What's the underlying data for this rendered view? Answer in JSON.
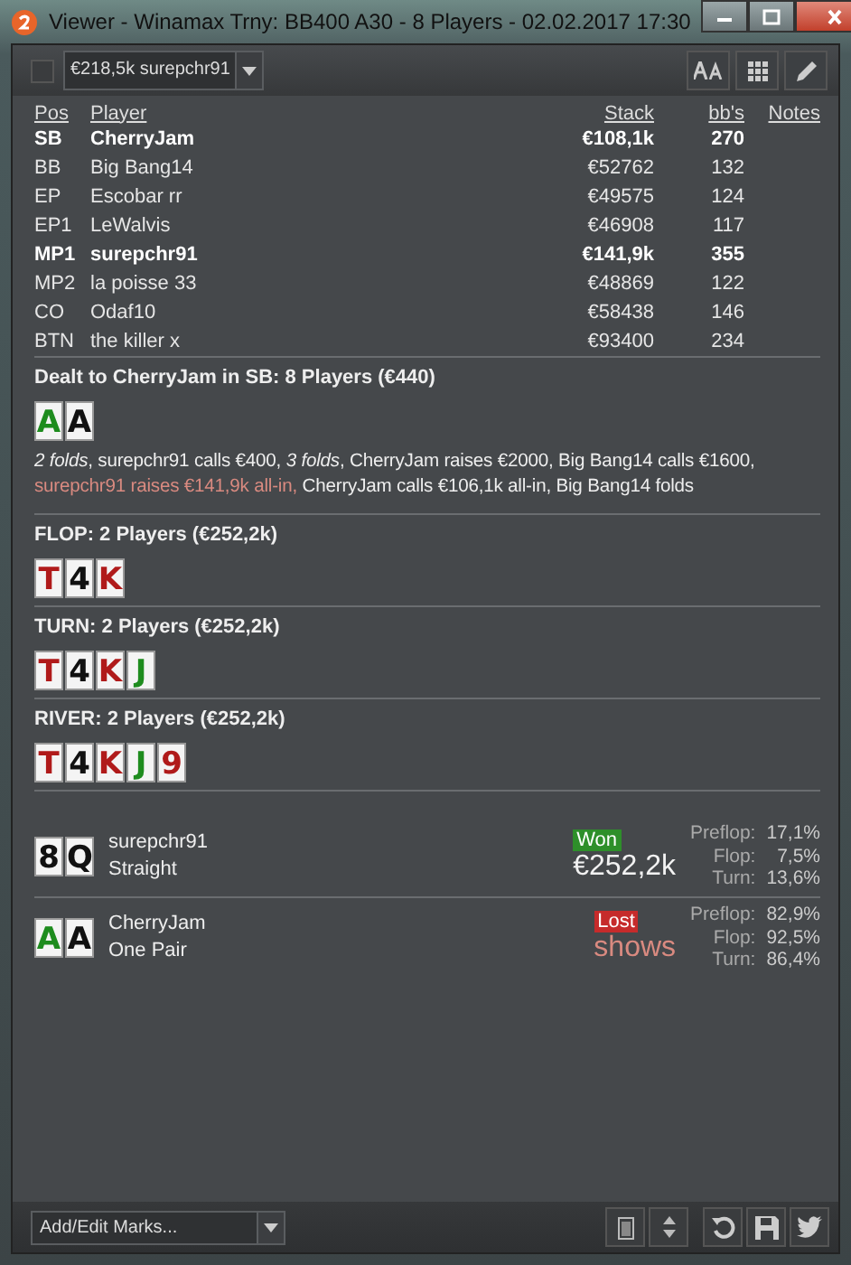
{
  "window": {
    "title": "Viewer - Winamax Trny: BB400 A30 - 8 Players - 02.02.2017 17:30"
  },
  "toolbar": {
    "checkbox_checked": false,
    "hand_select": "€218,5k surepchr91"
  },
  "players": {
    "columns": [
      "Pos",
      "Player",
      "Stack",
      "bb's",
      "Notes"
    ],
    "rows": [
      {
        "pos": "SB",
        "player": "CherryJam",
        "stack": "€108,1k",
        "bbs": "270",
        "bold": true
      },
      {
        "pos": "BB",
        "player": "Big Bang14",
        "stack": "€52762",
        "bbs": "132",
        "bold": false
      },
      {
        "pos": "EP",
        "player": "Escobar rr",
        "stack": "€49575",
        "bbs": "124",
        "bold": false
      },
      {
        "pos": "EP1",
        "player": "LeWalvis",
        "stack": "€46908",
        "bbs": "117",
        "bold": false
      },
      {
        "pos": "MP1",
        "player": "surepchr91",
        "stack": "€141,9k",
        "bbs": "355",
        "bold": true
      },
      {
        "pos": "MP2",
        "player": "la poisse 33",
        "stack": "€48869",
        "bbs": "122",
        "bold": false
      },
      {
        "pos": "CO",
        "player": "Odaf10",
        "stack": "€58438",
        "bbs": "146",
        "bold": false
      },
      {
        "pos": "BTN",
        "player": "the killer x",
        "stack": "€93400",
        "bbs": "234",
        "bold": false
      }
    ]
  },
  "streets": [
    {
      "heading": "Dealt to CherryJam in SB: 8 Players (€440)",
      "cards": [
        {
          "rank": "A",
          "color": "#1e8c1e"
        },
        {
          "rank": "A",
          "color": "#111111"
        }
      ],
      "actions": [
        {
          "text": "*2 folds*, surepchr91 calls €400, *3 folds*, CherryJam raises €2000, Big Bang14 calls €1600,",
          "highlight": false
        },
        {
          "text": "surepchr91 raises €141,9k all-in,",
          "highlight": true
        },
        {
          "text": "CherryJam calls €106,1k all-in, Big Bang14 folds",
          "highlight": false
        }
      ]
    },
    {
      "heading": "FLOP: 2 Players (€252,2k)",
      "cards": [
        {
          "rank": "T",
          "color": "#b01a1a"
        },
        {
          "rank": "4",
          "color": "#111111"
        },
        {
          "rank": "K",
          "color": "#b01a1a"
        }
      ]
    },
    {
      "heading": "TURN: 2 Players (€252,2k)",
      "cards": [
        {
          "rank": "T",
          "color": "#b01a1a"
        },
        {
          "rank": "4",
          "color": "#111111"
        },
        {
          "rank": "K",
          "color": "#b01a1a"
        },
        {
          "rank": "J",
          "color": "#1e8c1e"
        }
      ]
    },
    {
      "heading": "RIVER: 2 Players (€252,2k)",
      "cards": [
        {
          "rank": "T",
          "color": "#b01a1a"
        },
        {
          "rank": "4",
          "color": "#111111"
        },
        {
          "rank": "K",
          "color": "#b01a1a"
        },
        {
          "rank": "J",
          "color": "#1e8c1e"
        },
        {
          "rank": "9",
          "color": "#b01a1a"
        }
      ]
    }
  ],
  "results": [
    {
      "cards": [
        {
          "rank": "8",
          "color": "#111111"
        },
        {
          "rank": "Q",
          "color": "#111111"
        }
      ],
      "player": "surepchr91",
      "hand": "Straight",
      "outcome": {
        "label": "Won",
        "kind": "won"
      },
      "amount": "€252,2k",
      "equity": [
        {
          "label": "Preflop:",
          "value": "17,1%"
        },
        {
          "label": "Flop:",
          "value": "7,5%"
        },
        {
          "label": "Turn:",
          "value": "13,6%"
        }
      ]
    },
    {
      "cards": [
        {
          "rank": "A",
          "color": "#1e8c1e"
        },
        {
          "rank": "A",
          "color": "#111111"
        }
      ],
      "player": "CherryJam",
      "hand": "One Pair",
      "outcome": {
        "label": "Lost",
        "kind": "lost"
      },
      "amount": "shows",
      "equity": [
        {
          "label": "Preflop:",
          "value": "82,9%"
        },
        {
          "label": "Flop:",
          "value": "92,5%"
        },
        {
          "label": "Turn:",
          "value": "86,4%"
        }
      ]
    }
  ],
  "footer": {
    "marks_placeholder": "Add/Edit Marks..."
  }
}
